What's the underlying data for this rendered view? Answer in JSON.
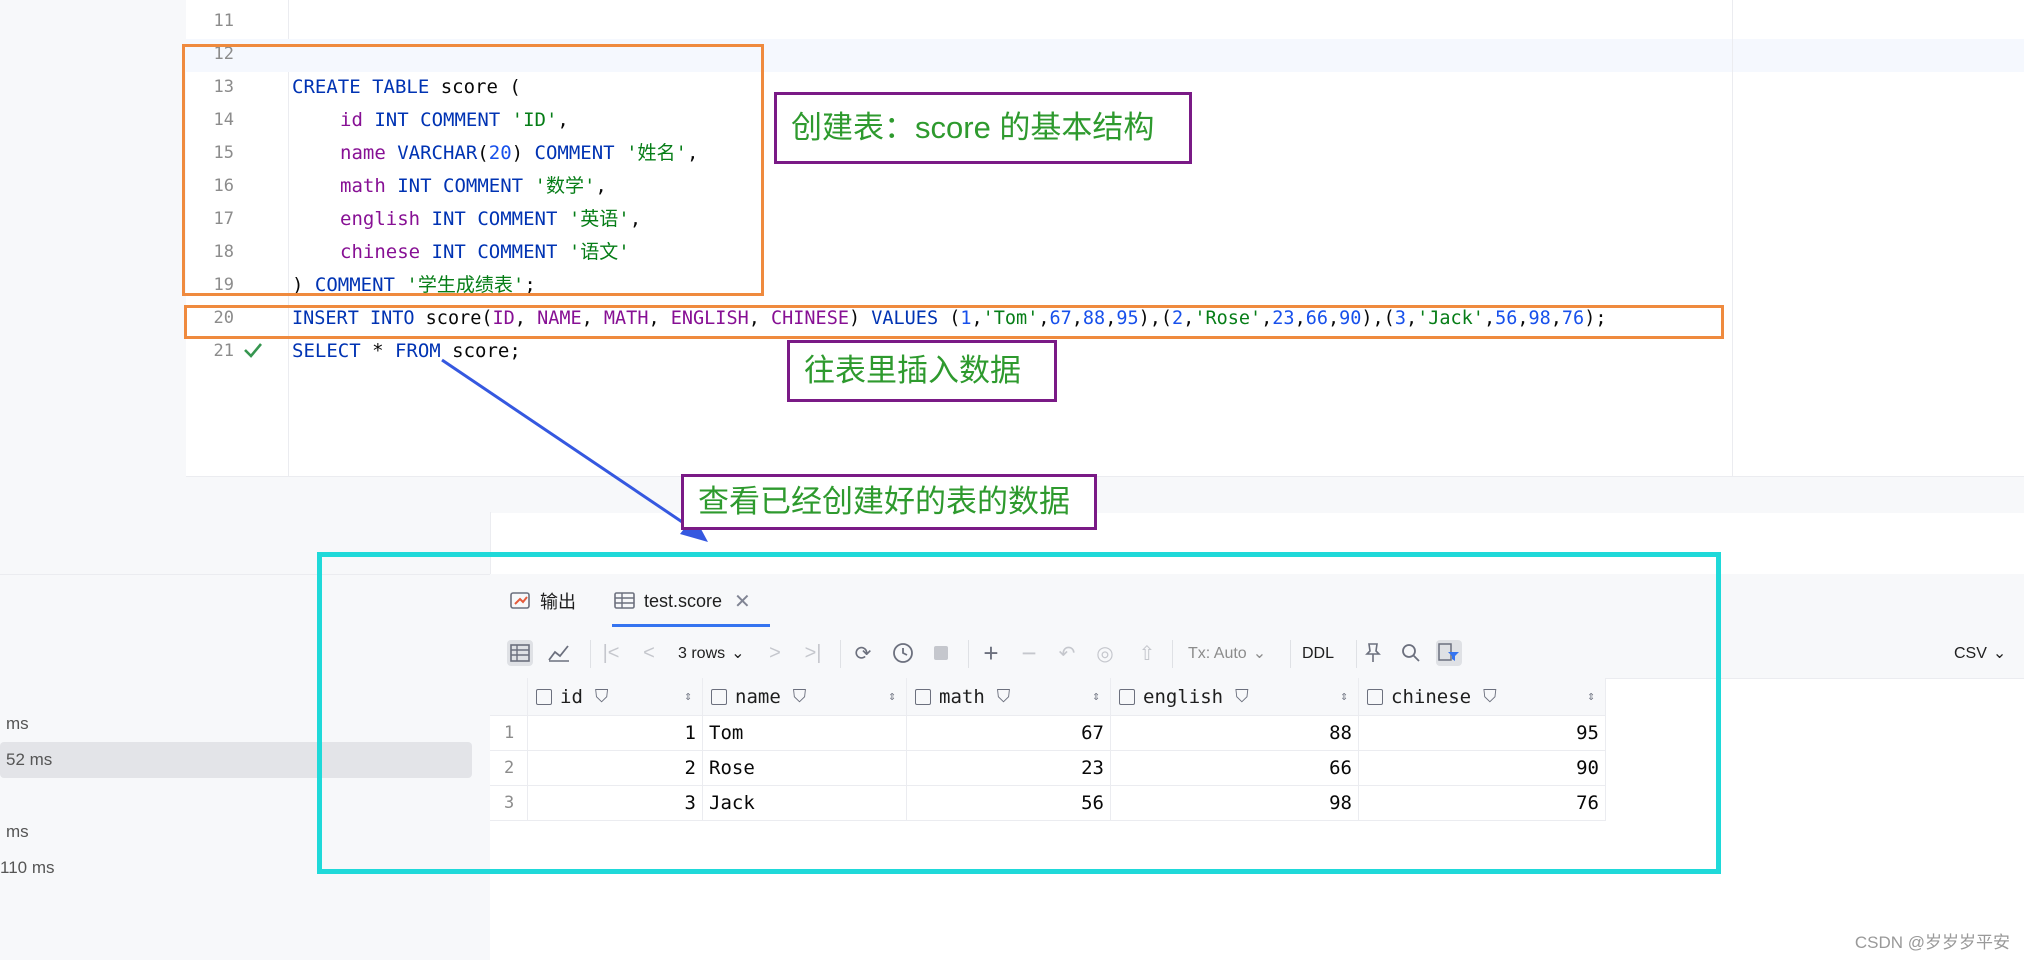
{
  "editor": {
    "lines": [
      {
        "n": "11"
      },
      {
        "n": "12"
      },
      {
        "n": "13"
      },
      {
        "n": "14"
      },
      {
        "n": "15"
      },
      {
        "n": "16"
      },
      {
        "n": "17"
      },
      {
        "n": "18"
      },
      {
        "n": "19"
      },
      {
        "n": "20"
      },
      {
        "n": "21"
      }
    ],
    "code": {
      "l13": [
        "CREATE",
        " ",
        "TABLE",
        " score ("
      ],
      "l14": [
        "id",
        " ",
        "INT",
        " ",
        "COMMENT",
        " ",
        "'ID'",
        ","
      ],
      "l15": [
        "name",
        " ",
        "VARCHAR",
        "(",
        "20",
        ") ",
        "COMMENT",
        " ",
        "'姓名'",
        ","
      ],
      "l16": [
        "math",
        " ",
        "INT",
        " ",
        "COMMENT",
        " ",
        "'数学'",
        ","
      ],
      "l17": [
        "english",
        " ",
        "INT",
        " ",
        "COMMENT",
        " ",
        "'英语'",
        ","
      ],
      "l18": [
        "chinese",
        " ",
        "INT",
        " ",
        "COMMENT",
        " ",
        "'语文'"
      ],
      "l19": [
        ") ",
        "COMMENT",
        " ",
        "'学生成绩表'",
        ";"
      ],
      "l20": [
        "INSERT",
        " ",
        "INTO",
        " score(",
        "ID",
        ", ",
        "NAME",
        ", ",
        "MATH",
        ", ",
        "ENGLISH",
        ", ",
        "CHINESE",
        ") ",
        "VALUES",
        " (",
        "1",
        ",",
        "'Tom'",
        ",",
        "67",
        ",",
        "88",
        ",",
        "95",
        "),(",
        "2",
        ",",
        "'Rose'",
        ",",
        "23",
        ",",
        "66",
        ",",
        "90",
        "),(",
        "3",
        ",",
        "'Jack'",
        ",",
        "56",
        ",",
        "98",
        ",",
        "76",
        ");"
      ],
      "l21": [
        "SELECT",
        " * ",
        "FROM",
        " score;"
      ]
    }
  },
  "annotations": {
    "create_note": "创建表：score 的基本结构",
    "insert_note": "往表里插入数据",
    "select_note": "查看已经创建好的表的数据"
  },
  "services": {
    "items": [
      "ms",
      "52 ms",
      "ms",
      "110 ms"
    ]
  },
  "results": {
    "tabs": [
      {
        "label": "输出",
        "icon": "output-icon"
      },
      {
        "label": "test.score",
        "icon": "table-icon"
      }
    ],
    "toolbar": {
      "rows_label": "3 rows",
      "tx_label": "Tx: Auto",
      "ddl_label": "DDL",
      "export_label": "CSV"
    },
    "columns": [
      "id",
      "name",
      "math",
      "english",
      "chinese"
    ],
    "rows": [
      {
        "num": "1",
        "id": "1",
        "name": "Tom",
        "math": "67",
        "english": "88",
        "chinese": "95"
      },
      {
        "num": "2",
        "id": "2",
        "name": "Rose",
        "math": "23",
        "english": "66",
        "chinese": "90"
      },
      {
        "num": "3",
        "id": "3",
        "name": "Jack",
        "math": "56",
        "english": "98",
        "chinese": "76"
      }
    ]
  },
  "watermark": "CSDN @岁岁岁平安",
  "colors": {
    "annotation_orange": "#ef8a3e",
    "annotation_purple": "#7a1a86",
    "annotation_text_green": "#2e9a2e",
    "highlight_cyan": "#1fd9d9",
    "arrow_blue": "#3558e0"
  }
}
